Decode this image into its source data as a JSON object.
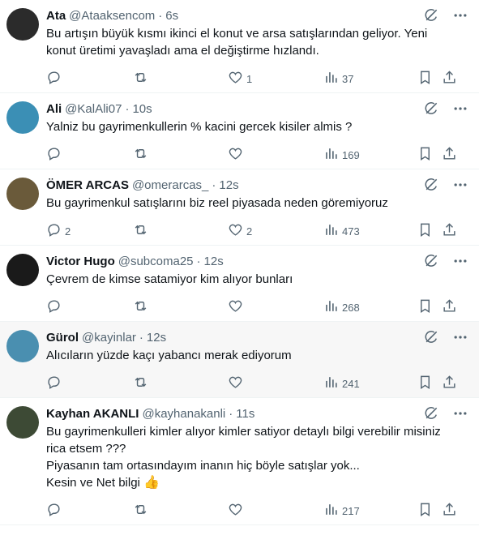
{
  "tweets": [
    {
      "name": "Ata",
      "handle": "@Ataaksencom",
      "time": "6s",
      "lines": [
        "Bu artışın büyük kısmı ikinci el konut ve arsa satışlarından geliyor. Yeni",
        "konut üretimi yavaşladı ama el değiştirme hızlandı."
      ],
      "replies": "",
      "retweets": "",
      "likes": "1",
      "views": "37",
      "avatar_color": "#2b2b2b",
      "highlight": false
    },
    {
      "name": "Ali",
      "handle": "@KalAli07",
      "time": "10s",
      "lines": [
        "Yalniz bu gayrimenkullerin % kacini gercek kisiler almis ?"
      ],
      "replies": "",
      "retweets": "",
      "likes": "",
      "views": "169",
      "avatar_color": "#3b8fb5",
      "highlight": false
    },
    {
      "name": "ÖMER ARCAS",
      "handle": "@omerarcas_",
      "time": "12s",
      "lines": [
        "Bu gayrimenkul satışlarını biz reel piyasada neden göremiyoruz"
      ],
      "replies": "2",
      "retweets": "",
      "likes": "2",
      "views": "473",
      "avatar_color": "#6a5a3a",
      "highlight": false
    },
    {
      "name": "Victor Hugo",
      "handle": "@subcoma25",
      "time": "12s",
      "lines": [
        "Çevrem de kimse satamiyor kim alıyor bunları"
      ],
      "replies": "",
      "retweets": "",
      "likes": "",
      "views": "268",
      "avatar_color": "#1a1a1a",
      "highlight": false
    },
    {
      "name": "Gürol",
      "handle": "@kayinlar",
      "time": "12s",
      "lines": [
        "Alıcıların yüzde kaçı yabancı merak ediyorum"
      ],
      "replies": "",
      "retweets": "",
      "likes": "",
      "views": "241",
      "avatar_color": "#4a8fb0",
      "highlight": true
    },
    {
      "name": "Kayhan AKANLI",
      "handle": "@kayhanakanli",
      "time": "11s",
      "lines": [
        "Bu gayrimenkulleri kimler alıyor kimler satiyor detaylı bilgi verebilir misiniz",
        "rica etsem ???",
        "Piyasanın tam ortasındayım inanın hiç böyle satışlar yok...",
        "Kesin ve Net bilgi"
      ],
      "emoji": "👍",
      "replies": "",
      "retweets": "",
      "likes": "",
      "views": "217",
      "avatar_color": "#3d4a35",
      "highlight": false
    }
  ],
  "icons": {
    "grok": "grok-icon",
    "more": "more-icon",
    "reply": "reply-icon",
    "retweet": "retweet-icon",
    "like": "like-icon",
    "views": "views-icon",
    "bookmark": "bookmark-icon",
    "share": "share-icon"
  }
}
